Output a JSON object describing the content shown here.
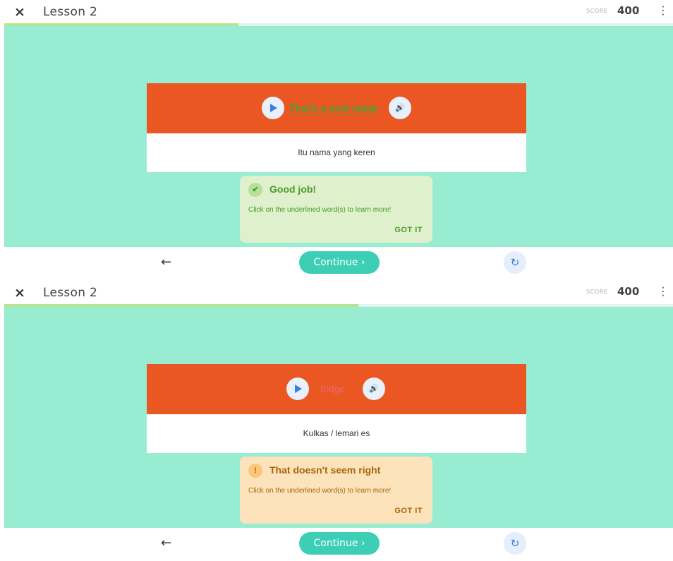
{
  "screens": [
    {
      "close_icon": "×",
      "lesson_title": "Lesson 2",
      "score_label": "SCORE",
      "score_value": "400",
      "menu_icon": "⋮",
      "progress_fraction": 0.35,
      "phrase": "That's a cool name",
      "phrase_color": "#3aa832",
      "translation": "Itu nama yang keren",
      "feedback": {
        "icon": "✔",
        "title": "Good job!",
        "message": "Click on the underlined word(s) to learn more!",
        "action": "GOT IT",
        "bg": "#dff1cc",
        "accent": "#4a9a27"
      },
      "nav": {
        "back_icon": "←",
        "continue_label": "Continue ›",
        "reset_icon": "↻"
      }
    },
    {
      "close_icon": "×",
      "lesson_title": "Lesson 2",
      "score_label": "SCORE",
      "score_value": "400",
      "menu_icon": "⋮",
      "progress_fraction": 0.53,
      "phrase": "fridge",
      "phrase_color": "#e8687a",
      "translation": "Kulkas / lemari es",
      "feedback": {
        "icon": "!",
        "title": "That doesn't seem right",
        "message": "Click on the underlined word(s) to learn more!",
        "action": "GOT IT",
        "bg": "#fde3bb",
        "accent": "#a8660c"
      },
      "nav": {
        "back_icon": "←",
        "continue_label": "Continue ›",
        "reset_icon": "↻"
      }
    }
  ],
  "colors": {
    "stage": "#98ecd2",
    "card_top": "#eb5723",
    "continue": "#3ccfb5",
    "progress": "#b6e58f"
  }
}
